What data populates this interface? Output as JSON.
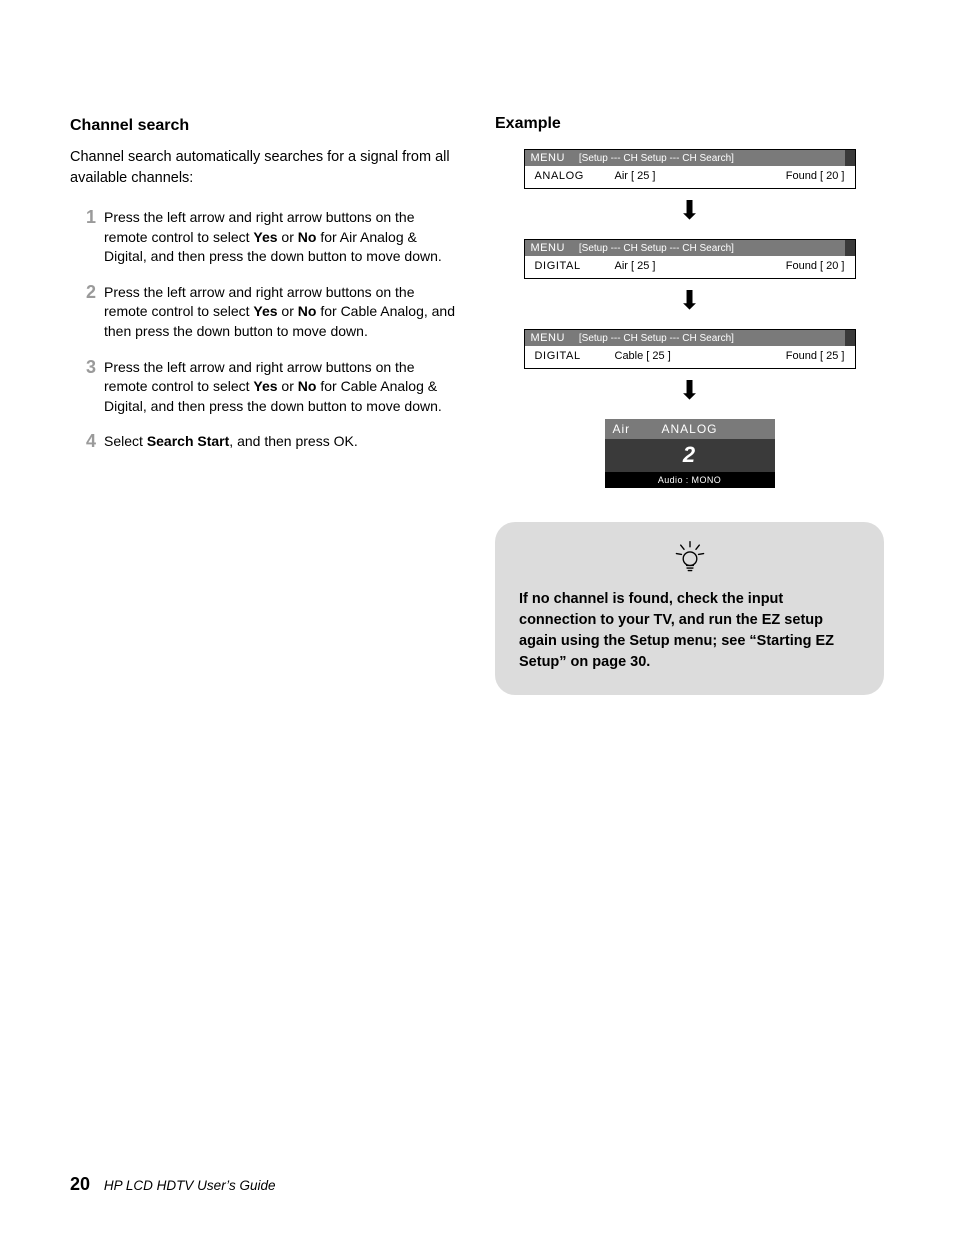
{
  "left": {
    "heading": "Channel search",
    "intro": "Channel search automatically searches for a signal from all available channels:",
    "steps": {
      "n1": "1",
      "s1a": "Press the left arrow and right arrow buttons on the remote control to select ",
      "s1b": "Yes",
      "s1c": " or ",
      "s1d": "No",
      "s1e": " for Air Analog & Digital, and then press the down button to move down.",
      "n2": "2",
      "s2a": "Press the left arrow and right arrow buttons on the remote control to select ",
      "s2b": "Yes",
      "s2c": " or ",
      "s2d": "No",
      "s2e": " for Cable Analog, and then press the down button to move down.",
      "n3": "3",
      "s3a": "Press the left arrow and right arrow buttons on the remote control to select ",
      "s3b": "Yes",
      "s3c": " or ",
      "s3d": "No",
      "s3e": " for Cable Analog & Digital, and then press the down button to move down.",
      "n4": "4",
      "s4a": "Select ",
      "s4b": "Search Start",
      "s4c": ", and then press OK."
    }
  },
  "right": {
    "heading": "Example",
    "menu_label": "MENU",
    "breadcrumb": "[Setup --- CH Setup --- CH Search]",
    "box1": {
      "type": "ANALOG",
      "src": "Air [  25 ]",
      "found": "Found [  20 ]"
    },
    "box2": {
      "type": "DIGITAL",
      "src": "Air [  25 ]",
      "found": "Found [  20 ]"
    },
    "box3": {
      "type": "DIGITAL",
      "src": "Cable [  25 ]",
      "found": "Found [  25 ]"
    },
    "result": {
      "left": "Air",
      "right": "ANALOG",
      "value": "2",
      "audio": "Audio   :   MONO"
    },
    "tip": "If no channel is found, check the input connection to your TV, and run the EZ setup again using the Setup menu; see “Starting EZ Setup” on page 30."
  },
  "footer": {
    "page": "20",
    "title": "HP LCD HDTV User’s Guide"
  }
}
